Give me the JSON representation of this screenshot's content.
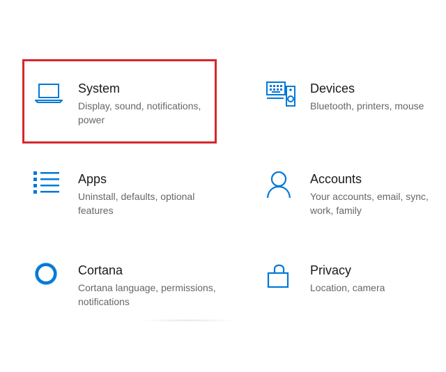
{
  "settings": {
    "accent_color": "#0078d7",
    "highlight_color": "#d7262a",
    "tiles": [
      {
        "title": "System",
        "description": "Display, sound, notifications, power",
        "icon": "laptop-icon"
      },
      {
        "title": "Devices",
        "description": "Bluetooth, printers, mouse",
        "icon": "keyboard-speaker-icon"
      },
      {
        "title": "Apps",
        "description": "Uninstall, defaults, optional features",
        "icon": "apps-list-icon"
      },
      {
        "title": "Accounts",
        "description": "Your accounts, email, sync, work, family",
        "icon": "person-icon"
      },
      {
        "title": "Cortana",
        "description": "Cortana language, permissions, notifications",
        "icon": "cortana-ring-icon"
      },
      {
        "title": "Privacy",
        "description": "Location, camera",
        "icon": "lock-icon"
      }
    ]
  }
}
